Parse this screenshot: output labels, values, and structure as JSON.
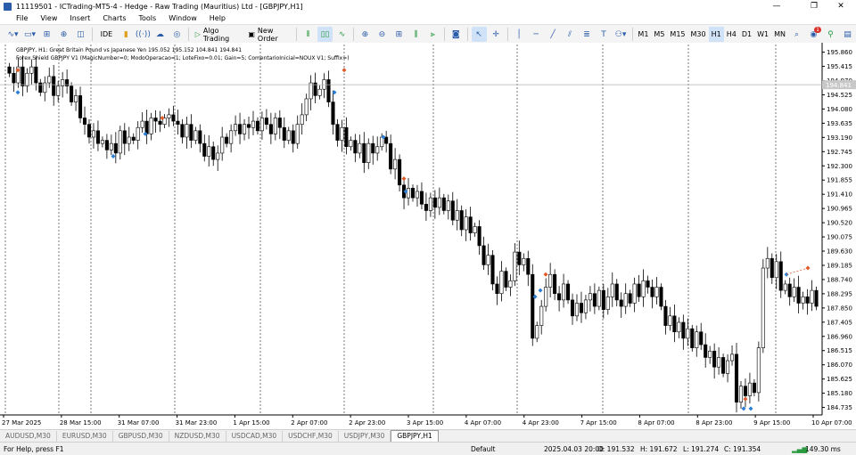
{
  "window": {
    "title": "11119501 - ICTrading-MT5-4 - Hedge - Raw Trading (Mauritius) Ltd - [GBPJPY,H1]"
  },
  "menu": [
    "File",
    "View",
    "Insert",
    "Charts",
    "Tools",
    "Window",
    "Help"
  ],
  "toolbar": {
    "ide_label": "IDE",
    "algo_label": "Algo Trading",
    "order_label": "New Order",
    "timeframes": [
      "M1",
      "M5",
      "M15",
      "M30",
      "H1",
      "H4",
      "D1",
      "W1",
      "MN"
    ],
    "active_timeframe": "H1",
    "notify_count": "1"
  },
  "chart": {
    "header": "GBPJPY, H1:  Great Britain Pound vs Japanese Yen  195.052 195.152 104.841 194.841",
    "indicator": "Forex Shield GBPJPY V1 (MagicNumber=0; ModoOperacao=1; LoteFixo=0.01; Gain=5; ComentarioInicial=NOUX V1; Suffix=)",
    "price_labels": [
      "195.860",
      "195.415",
      "194.970",
      "194.525",
      "194.080",
      "193.635",
      "193.190",
      "192.745",
      "192.300",
      "191.855",
      "191.410",
      "190.965",
      "190.520",
      "190.075",
      "189.630",
      "189.185",
      "188.740",
      "188.295",
      "187.850",
      "187.405",
      "186.960",
      "186.515",
      "186.070",
      "185.625",
      "185.180",
      "184.735"
    ],
    "current_price": "194.841",
    "time_labels": [
      "27 Mar 2025",
      "28 Mar 15:00",
      "31 Mar 07:00",
      "31 Mar 23:00",
      "1 Apr 15:00",
      "2 Apr 07:00",
      "2 Apr 23:00",
      "3 Apr 15:00",
      "4 Apr 07:00",
      "4 Apr 23:00",
      "7 Apr 15:00",
      "8 Apr 07:00",
      "8 Apr 23:00",
      "9 Apr 15:00",
      "10 Apr 07:00"
    ],
    "colors": {
      "up": "#ffffff",
      "down": "#000000",
      "buy_marker": "#2a7fd4",
      "sell_marker": "#e05a2a",
      "grid": "#555555"
    }
  },
  "chart_data": {
    "type": "candlestick",
    "symbol": "GBPJPY",
    "timeframe": "H1",
    "ylim": [
      184.5,
      196.1
    ],
    "close": [
      195.2,
      194.9,
      195.4,
      194.8,
      195.2,
      195.4,
      194.9,
      194.6,
      194.9,
      195.1,
      194.5,
      194.8,
      195.0,
      194.8,
      194.3,
      194.5,
      193.8,
      193.6,
      193.2,
      193.4,
      193.0,
      193.1,
      192.8,
      193.0,
      192.7,
      193.4,
      193.0,
      193.2,
      193.1,
      193.5,
      193.7,
      193.3,
      193.8,
      193.7,
      193.6,
      193.8,
      193.9,
      193.7,
      193.6,
      193.2,
      193.6,
      193.1,
      193.4,
      193.0,
      192.6,
      192.9,
      192.5,
      192.7,
      193.2,
      193.0,
      193.4,
      193.6,
      193.3,
      193.6,
      193.5,
      193.7,
      193.4,
      193.8,
      193.6,
      193.3,
      193.8,
      193.5,
      193.1,
      193.4,
      193.0,
      193.6,
      193.9,
      194.4,
      194.9,
      194.5,
      194.7,
      195.0,
      194.3,
      193.6,
      193.1,
      193.5,
      192.9,
      193.1,
      192.7,
      193.0,
      192.4,
      193.0,
      192.7,
      192.9,
      193.2,
      193.0,
      192.2,
      192.5,
      191.7,
      191.3,
      191.6,
      191.3,
      191.5,
      191.1,
      190.9,
      191.3,
      191.0,
      191.3,
      190.9,
      191.2,
      190.6,
      190.9,
      190.3,
      190.7,
      190.2,
      190.4,
      189.8,
      189.2,
      189.5,
      188.6,
      188.3,
      189.0,
      188.5,
      188.7,
      189.6,
      189.2,
      189.4,
      188.9,
      186.9,
      187.3,
      187.9,
      188.5,
      188.9,
      188.3,
      188.1,
      188.6,
      188.1,
      187.6,
      188.0,
      187.7,
      188.1,
      188.3,
      187.9,
      188.4,
      187.8,
      188.2,
      188.6,
      188.1,
      187.9,
      188.3,
      188.0,
      188.6,
      188.2,
      188.7,
      188.5,
      188.2,
      188.5,
      187.9,
      187.3,
      187.6,
      187.1,
      187.4,
      186.9,
      187.2,
      186.6,
      187.1,
      186.7,
      186.3,
      186.5,
      186.0,
      186.3,
      185.8,
      186.2,
      186.4,
      184.9,
      185.4,
      185.1,
      185.5,
      185.2,
      186.6,
      189.1,
      189.4,
      188.8,
      189.3,
      188.4,
      188.6,
      188.2,
      188.5,
      188.0,
      188.2,
      188.0,
      188.4,
      187.9
    ]
  },
  "tabs": [
    "AUDUSD,M30",
    "EURUSD,M30",
    "GBPUSD,M30",
    "NZDUSD,M30",
    "USDCAD,M30",
    "USDCHF,M30",
    "USDJPY,M30",
    "GBPJPY,H1"
  ],
  "active_tab": "GBPJPY,H1",
  "status": {
    "help": "For Help, press F1",
    "profile": "Default",
    "datetime": "2025.04.03 20:00",
    "open": "O: 191.532",
    "high": "H: 191.672",
    "low": "L: 191.274",
    "close": "C: 191.354",
    "ping": "149.30 ms"
  }
}
